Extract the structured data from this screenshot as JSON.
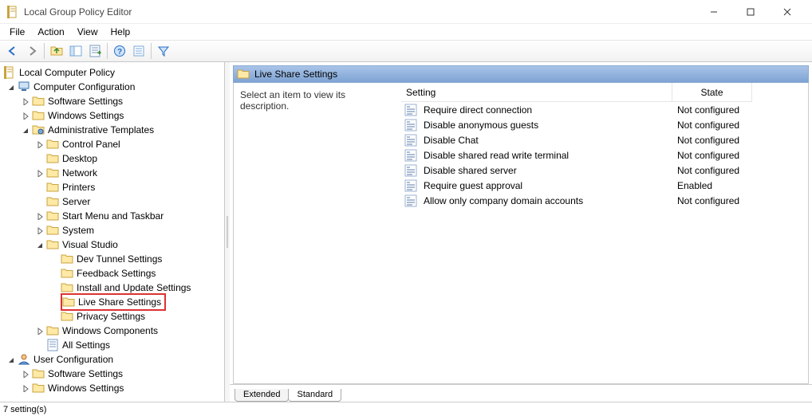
{
  "window": {
    "title": "Local Group Policy Editor",
    "root_label": "Local Computer Policy"
  },
  "menus": [
    "File",
    "Action",
    "View",
    "Help"
  ],
  "tree": {
    "computer_config": "Computer Configuration",
    "cc_software": "Software Settings",
    "cc_windows": "Windows Settings",
    "cc_admin": "Administrative Templates",
    "cc_admin_ctrl": "Control Panel",
    "cc_admin_desktop": "Desktop",
    "cc_admin_network": "Network",
    "cc_admin_printers": "Printers",
    "cc_admin_server": "Server",
    "cc_admin_start": "Start Menu and Taskbar",
    "cc_admin_system": "System",
    "cc_admin_vs": "Visual Studio",
    "vs_devtunnel": "Dev Tunnel Settings",
    "vs_feedback": "Feedback Settings",
    "vs_install": "Install and Update Settings",
    "vs_liveshare": "Live Share Settings",
    "vs_privacy": "Privacy Settings",
    "cc_admin_wincomp": "Windows Components",
    "cc_admin_all": "All Settings",
    "user_config": "User Configuration",
    "uc_software": "Software Settings",
    "uc_windows": "Windows Settings"
  },
  "detail": {
    "header": "Live Share Settings",
    "desc_prompt": "Select an item to view its description.",
    "col_setting": "Setting",
    "col_state": "State",
    "rows": [
      {
        "name": "Require direct connection",
        "state": "Not configured"
      },
      {
        "name": "Disable anonymous guests",
        "state": "Not configured"
      },
      {
        "name": "Disable Chat",
        "state": "Not configured"
      },
      {
        "name": "Disable shared read write terminal",
        "state": "Not configured"
      },
      {
        "name": "Disable shared server",
        "state": "Not configured"
      },
      {
        "name": "Require guest approval",
        "state": "Enabled"
      },
      {
        "name": "Allow only company domain accounts",
        "state": "Not configured"
      }
    ]
  },
  "tabs": {
    "extended": "Extended",
    "standard": "Standard"
  },
  "status": "7 setting(s)"
}
